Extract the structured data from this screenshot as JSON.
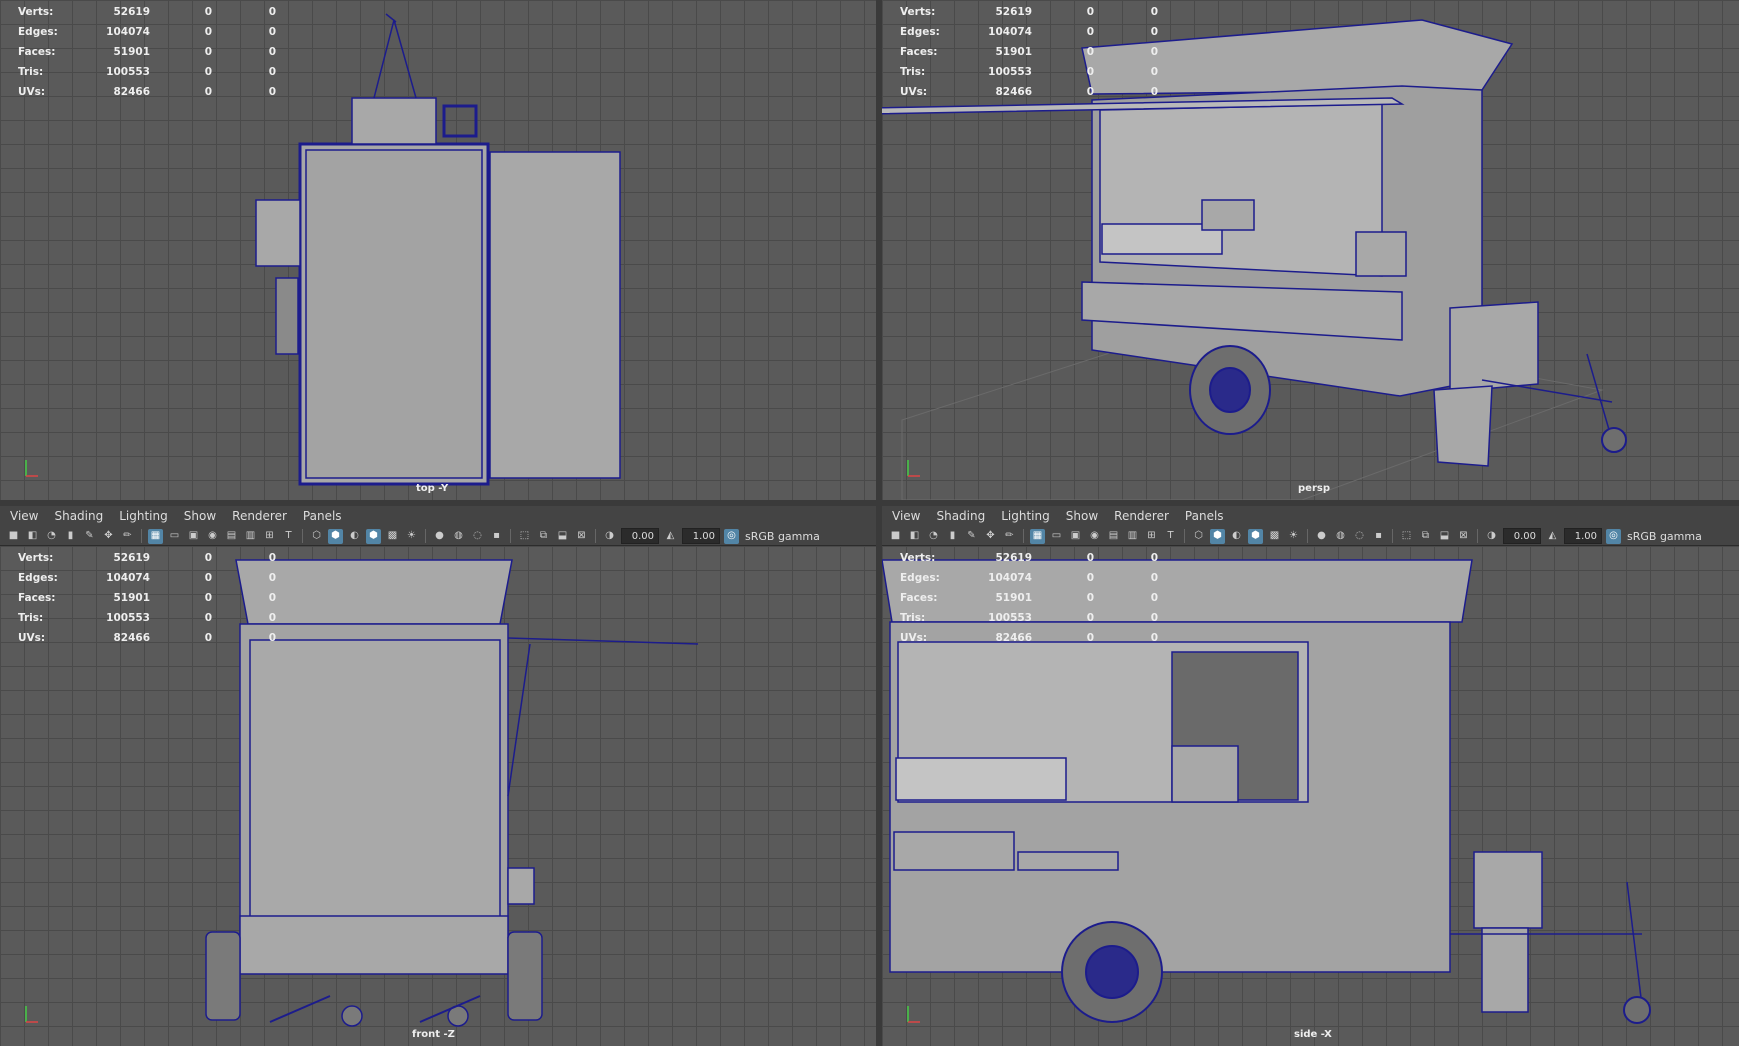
{
  "hud": {
    "rows": [
      {
        "label": "Verts:",
        "value": "52619",
        "sel": "0",
        "comp": "0"
      },
      {
        "label": "Edges:",
        "value": "104074",
        "sel": "0",
        "comp": "0"
      },
      {
        "label": "Faces:",
        "value": "51901",
        "sel": "0",
        "comp": "0"
      },
      {
        "label": "Tris:",
        "value": "100553",
        "sel": "0",
        "comp": "0"
      },
      {
        "label": "UVs:",
        "value": "82466",
        "sel": "0",
        "comp": "0"
      }
    ]
  },
  "cameras": {
    "top": "top -Y",
    "persp": "persp",
    "front": "front -Z",
    "side": "side -X"
  },
  "panel_menu": [
    "View",
    "Shading",
    "Lighting",
    "Show",
    "Renderer",
    "Panels"
  ],
  "toolbar": {
    "exposure": "0.00",
    "gamma": "1.00",
    "colorspace": "sRGB gamma"
  },
  "colors": {
    "viewport_bg": "#5a5a5a",
    "wire": "#1c1c8c",
    "mesh_fill": "#a8a8a8",
    "active_icon": "#5285a6"
  }
}
